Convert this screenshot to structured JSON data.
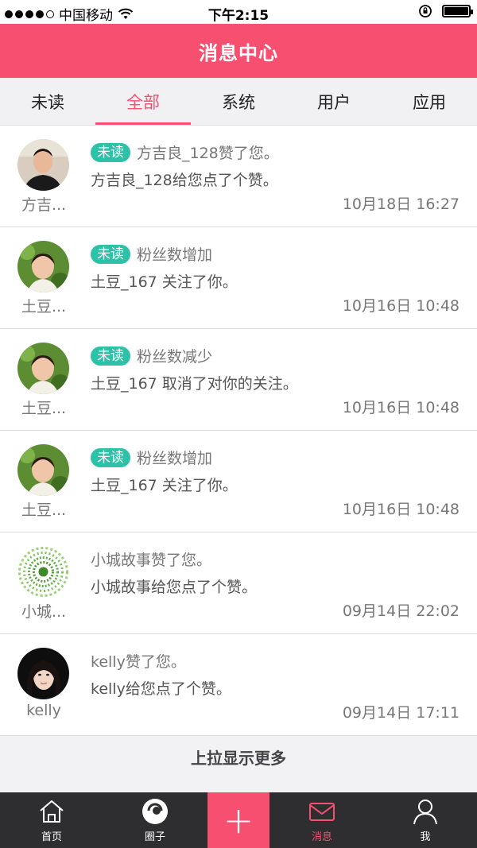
{
  "status_bar": {
    "carrier": "中国移动",
    "time": "下午2:15"
  },
  "header": {
    "title": "消息中心"
  },
  "tabs": [
    {
      "label": "未读",
      "active": false
    },
    {
      "label": "全部",
      "active": true
    },
    {
      "label": "系统",
      "active": false
    },
    {
      "label": "用户",
      "active": false
    },
    {
      "label": "应用",
      "active": false
    }
  ],
  "messages": [
    {
      "avatar_name": "方吉...",
      "badge": "未读",
      "title": "方吉良_128赞了您。",
      "body": "方吉良_128给您点了个赞。",
      "time": "10月18日 16:27"
    },
    {
      "avatar_name": "土豆...",
      "badge": "未读",
      "title": "粉丝数增加",
      "body": "土豆_167 关注了你。",
      "time": "10月16日 10:48"
    },
    {
      "avatar_name": "土豆...",
      "badge": "未读",
      "title": "粉丝数减少",
      "body": "土豆_167 取消了对你的关注。",
      "time": "10月16日 10:48"
    },
    {
      "avatar_name": "土豆...",
      "badge": "未读",
      "title": "粉丝数增加",
      "body": "土豆_167 关注了你。",
      "time": "10月16日 10:48"
    },
    {
      "avatar_name": "小城...",
      "badge": "",
      "title": "小城故事赞了您。",
      "body": "小城故事给您点了个赞。",
      "time": "09月14日 22:02"
    },
    {
      "avatar_name": "kelly",
      "badge": "",
      "title": "kelly赞了您。",
      "body": "kelly给您点了个赞。",
      "time": "09月14日 17:11"
    }
  ],
  "load_more": "上拉显示更多",
  "tabbar": {
    "home": "首页",
    "circle": "圈子",
    "messages": "消息",
    "me": "我"
  },
  "colors": {
    "brand": "#f74f6f",
    "badge": "#2bc2a8",
    "tabbar_bg": "#2e2e30"
  }
}
